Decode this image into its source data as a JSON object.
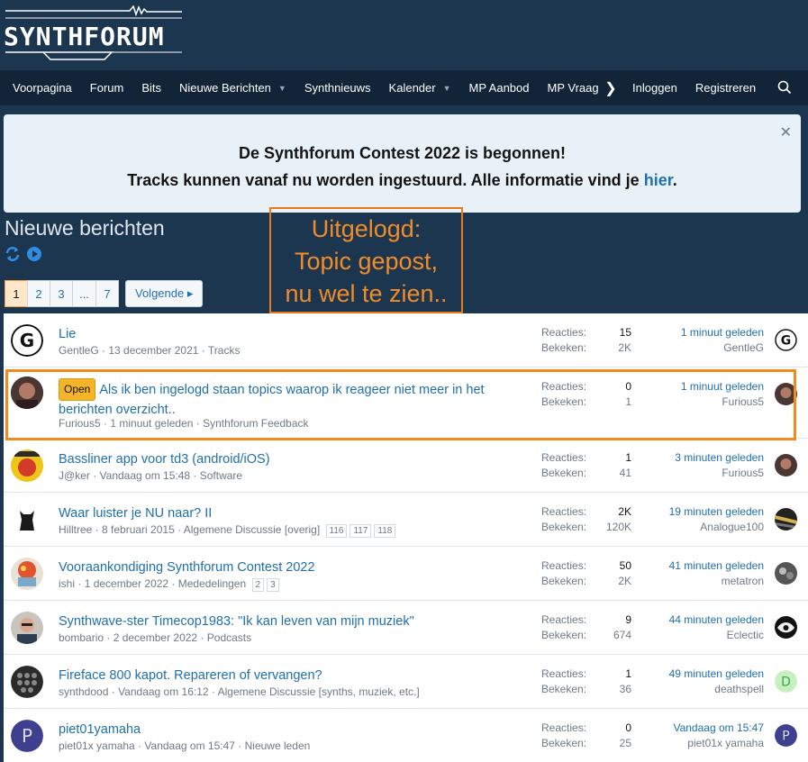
{
  "brand": {
    "logo_text": "SYNTHFORUM"
  },
  "nav": {
    "items": [
      {
        "label": "Voorpagina",
        "dropdown": false
      },
      {
        "label": "Forum",
        "dropdown": false
      },
      {
        "label": "Bits",
        "dropdown": false
      },
      {
        "label": "Nieuwe Berichten",
        "dropdown": true
      },
      {
        "label": "Synthnieuws",
        "dropdown": false
      },
      {
        "label": "Kalender",
        "dropdown": true
      },
      {
        "label": "MP Aanbod",
        "dropdown": false
      },
      {
        "label": "MP Vraag",
        "dropdown": false
      }
    ],
    "login": "Inloggen",
    "register": "Registreren"
  },
  "notice": {
    "line1": "De Synthforum Contest 2022 is begonnen!",
    "line2_prefix": "Tracks kunnen vanaf nu worden ingestuurd. Alle informatie vind je ",
    "line2_link": "hier",
    "line2_suffix": ".",
    "close": "✕"
  },
  "page": {
    "title": "Nieuwe berichten"
  },
  "annotation": {
    "line1": "Uitgelogd:",
    "line2": "Topic gepost,",
    "line3": "nu wel te zien.."
  },
  "pagination": {
    "pages": [
      "1",
      "2",
      "3",
      "...",
      "7"
    ],
    "current": "1",
    "next": "Volgende ▸"
  },
  "labels": {
    "replies": "Reacties:",
    "views": "Bekeken:",
    "open": "Open"
  },
  "threads": [
    {
      "title": "Lie",
      "author": "GentleG",
      "date": "13 december 2021",
      "forum": "Tracks",
      "replies": "15",
      "views": "2K",
      "last_when": "1 minuut geleden",
      "last_who": "GentleG",
      "avatar": "G",
      "pages": []
    },
    {
      "title": "Als ik ben ingelogd staan topics waarop ik reageer niet meer in het berichten overzicht..",
      "prefix": "Open",
      "author": "Furious5",
      "date": "1 minuut geleden",
      "forum": "Synthforum Feedback",
      "replies": "0",
      "views": "1",
      "last_when": "1 minuut geleden",
      "last_who": "Furious5",
      "avatar": "",
      "pages": []
    },
    {
      "title": "Bassliner app voor td3 (android/iOS)",
      "author": "J@ker",
      "date": "Vandaag om 15:48",
      "forum": "Software",
      "replies": "1",
      "views": "41",
      "last_when": "3 minuten geleden",
      "last_who": "Furious5",
      "avatar": "",
      "pages": []
    },
    {
      "title": "Waar luister je NU naar? II",
      "author": "Hilltree",
      "date": "8 februari 2015",
      "forum": "Algemene Discussie [overig]",
      "replies": "2K",
      "views": "120K",
      "last_when": "19 minuten geleden",
      "last_who": "Analogue100",
      "avatar": "",
      "pages": [
        "116",
        "117",
        "118"
      ]
    },
    {
      "title": "Vooraankondiging Synthforum Contest 2022",
      "author": "ishi",
      "date": "1 december 2022",
      "forum": "Mededelingen",
      "replies": "50",
      "views": "2K",
      "last_when": "41 minuten geleden",
      "last_who": "metatron",
      "avatar": "",
      "pages": [
        "2",
        "3"
      ]
    },
    {
      "title": "Synthwave-ster Timecop1983: \"Ik kan leven van mijn muziek\"",
      "author": "bombario",
      "date": "2 december 2022",
      "forum": "Podcasts",
      "replies": "9",
      "views": "674",
      "last_when": "44 minuten geleden",
      "last_who": "Eclectic",
      "avatar": "",
      "pages": []
    },
    {
      "title": "Fireface 800 kapot. Repareren of vervangen?",
      "author": "synthdood",
      "date": "Vandaag om 16:12",
      "forum": "Algemene Discussie [synths, muziek, etc.]",
      "replies": "1",
      "views": "36",
      "last_when": "49 minuten geleden",
      "last_who": "deathspell",
      "avatar": "",
      "last_avatar": "D",
      "pages": []
    },
    {
      "title": "piet01yamaha",
      "author": "piet01x yamaha",
      "date": "Vandaag om 15:47",
      "forum": "Nieuwe leden",
      "replies": "0",
      "views": "25",
      "last_when": "Vandaag om 15:47",
      "last_who": "piet01x yamaha",
      "avatar": "P",
      "last_avatar": "P",
      "pages": []
    }
  ],
  "colors": {
    "bg": "#1c3650",
    "nav": "#122437",
    "link": "#1f6fae",
    "accent": "#f28a1e"
  }
}
